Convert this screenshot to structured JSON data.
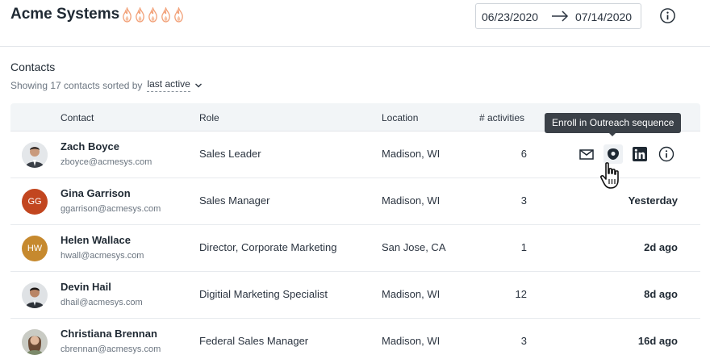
{
  "header": {
    "app_title": "Acme Systems",
    "flame_count_icons": [
      "flame-icon",
      "flame-icon",
      "flame-icon",
      "flame-icon",
      "flame-icon"
    ],
    "date_start": "06/23/2020",
    "date_end": "07/14/2020",
    "info_icon": "info-icon"
  },
  "contacts": {
    "title": "Contacts",
    "showing_text": "Showing 17 contacts sorted by",
    "sort_value": "last active",
    "columns": {
      "contact": "Contact",
      "role": "Role",
      "location": "Location",
      "activities": "# activities"
    },
    "rows": [
      {
        "name": "Zach Boyce",
        "email": "zboyce@acmesys.com",
        "role": "Sales Leader",
        "location": "Madison, WI",
        "activities": "6",
        "last_active": "",
        "avatar_type": "photo",
        "avatar_initials": ""
      },
      {
        "name": "Gina Garrison",
        "email": "ggarrison@acmesys.com",
        "role": "Sales Manager",
        "location": "Madison, WI",
        "activities": "3",
        "last_active": "Yesterday",
        "avatar_type": "initials",
        "avatar_initials": "GG"
      },
      {
        "name": "Helen Wallace",
        "email": "hwall@acmesys.com",
        "role": "Director, Corporate Marketing",
        "location": "San Jose, CA",
        "activities": "1",
        "last_active": "2d ago",
        "avatar_type": "initials",
        "avatar_initials": "HW"
      },
      {
        "name": "Devin Hail",
        "email": "dhail@acmesys.com",
        "role": "Digitial Marketing Specialist",
        "location": "Madison, WI",
        "activities": "12",
        "last_active": "8d ago",
        "avatar_type": "photo",
        "avatar_initials": ""
      },
      {
        "name": "Christiana Brennan",
        "email": "cbrennan@acmesys.com",
        "role": "Federal Sales Manager",
        "location": "Madison, WI",
        "activities": "3",
        "last_active": "16d ago",
        "avatar_type": "photo",
        "avatar_initials": ""
      }
    ]
  },
  "row_actions": {
    "icons": [
      "mail-icon",
      "outreach-icon",
      "linkedin-icon",
      "info-icon"
    ],
    "tooltip": "Enroll in Outreach sequence"
  },
  "colors": {
    "gina_avatar": "#c2461f",
    "helen_avatar": "#c6892e",
    "tooltip_bg": "#3b4148",
    "header_bg": "#f2f5f7",
    "flame": "#f2a27a"
  }
}
